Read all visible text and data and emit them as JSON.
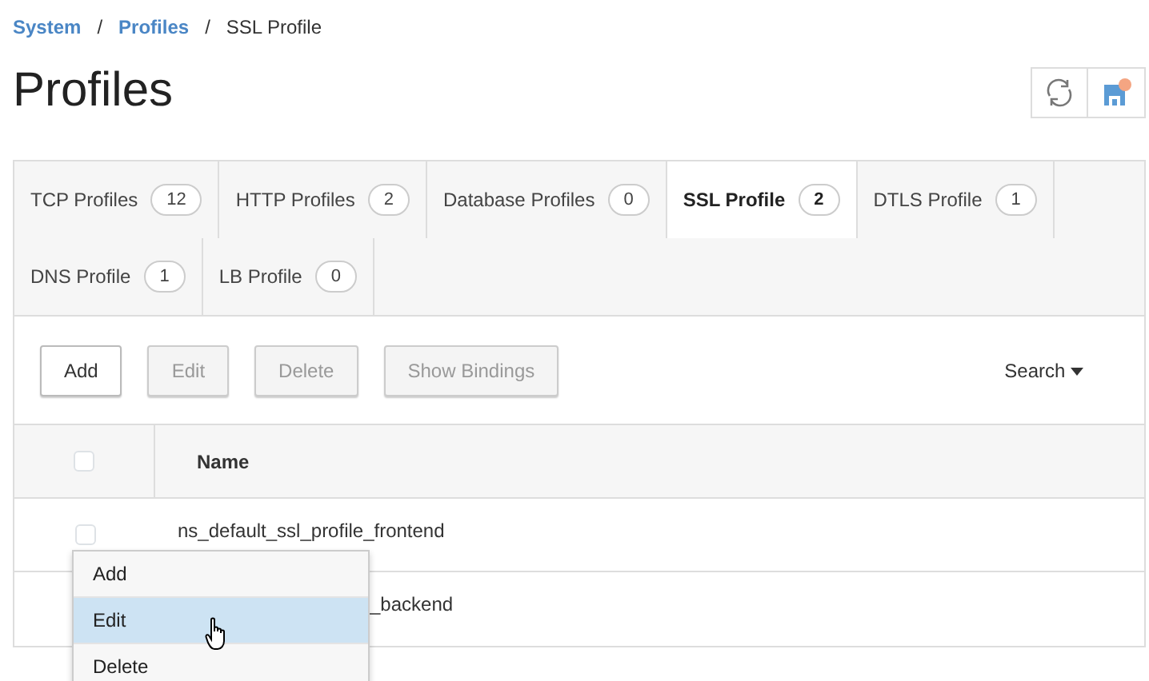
{
  "breadcrumb": {
    "separator": "/",
    "items": [
      {
        "label": "System",
        "link": true
      },
      {
        "label": "Profiles",
        "link": true
      },
      {
        "label": "SSL Profile",
        "link": false
      }
    ]
  },
  "title": "Profiles",
  "tabs": [
    {
      "label": "TCP Profiles",
      "count": "12",
      "selected": false
    },
    {
      "label": "HTTP Profiles",
      "count": "2",
      "selected": false
    },
    {
      "label": "Database Profiles",
      "count": "0",
      "selected": false
    },
    {
      "label": "SSL Profile",
      "count": "2",
      "selected": true
    },
    {
      "label": "DTLS Profile",
      "count": "1",
      "selected": false
    },
    {
      "label": "DNS Profile",
      "count": "1",
      "selected": false
    },
    {
      "label": "LB Profile",
      "count": "0",
      "selected": false
    }
  ],
  "toolbar": {
    "buttons": [
      {
        "label": "Add",
        "disabled": false
      },
      {
        "label": "Edit",
        "disabled": true
      },
      {
        "label": "Delete",
        "disabled": true
      },
      {
        "label": "Show Bindings",
        "disabled": true
      }
    ],
    "search": "Search"
  },
  "table": {
    "columns": [
      "Name"
    ],
    "header_checked": false,
    "rows": [
      {
        "name": "ns_default_ssl_profile_frontend",
        "checked": false
      },
      {
        "name": "_backend"
      }
    ]
  },
  "context_menu": [
    {
      "label": "Add",
      "selected": false
    },
    {
      "label": "Edit",
      "selected": true
    },
    {
      "label": "Delete",
      "selected": false
    }
  ]
}
